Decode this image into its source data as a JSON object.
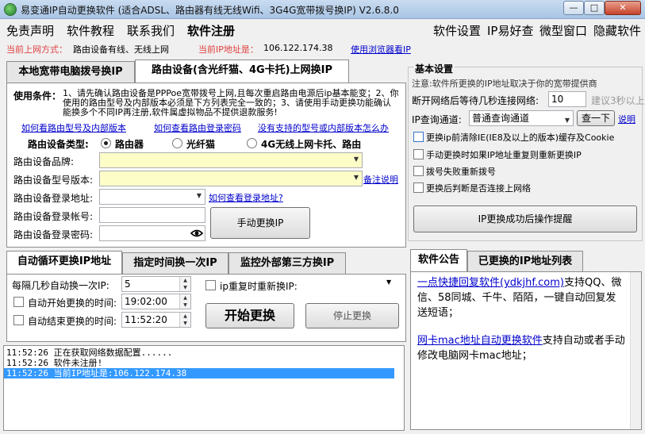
{
  "window": {
    "title": "易变通IP自动更换软件 (适合ADSL、路由器有线无线Wifi、3G4G宽带拨号换IP) V2.6.8.0",
    "min": "—",
    "max": "□",
    "close": "✕"
  },
  "menu": {
    "left": [
      "免责声明",
      "软件教程",
      "联系我们",
      "软件注册"
    ],
    "right": [
      "软件设置",
      "IP易好查",
      "微型窗口",
      "隐藏软件"
    ]
  },
  "status": {
    "mode_label": "当前上网方式：",
    "mode_value": "路由设备有线、无线上网",
    "ip_label": "当前IP地址是：",
    "ip_value": "106.122.174.38",
    "browser_link": "使用浏览器看IP"
  },
  "top_tabs": [
    "本地宽带电脑拨号换IP",
    "路由设备(含光纤猫、4G卡托)上网换IP"
  ],
  "router": {
    "conditions_label": "使用条件：",
    "conditions_text": "1、请先确认路由设备是PPPoe宽带拨号上网,且每次重启路由电源后ip基本能变；2、你使用的路由型号及内部版本必须是下方列表完全一致的；3、请使用手动更换功能确认能换多个不同IP再注册,软件属虚拟物品不提供退款服务!",
    "links": [
      "如何看路由型号及内部版本",
      "如何查看路由登录密码",
      "没有支持的型号或内部版本怎么办"
    ],
    "type_label": "路由设备类型:",
    "types": [
      "路由器",
      "光纤猫",
      "4G无线上网卡托、路由"
    ],
    "brand_label": "路由设备品牌:",
    "model_label": "路由设备型号版本:",
    "note_link": "备注说明",
    "addr_label": "路由设备登录地址:",
    "addr_link": "如何查看登录地址?",
    "account_label": "路由设备登录帐号:",
    "password_label": "路由设备登录密码:",
    "eye_icon": "eye-icon",
    "manual_button": "手动更换IP"
  },
  "bottom_tabs": [
    "自动循环更换IP地址",
    "指定时间换一次IP",
    "监控外部第三方换IP"
  ],
  "auto": {
    "interval_label": "每隔几秒自动换一次IP:",
    "interval_value": "5",
    "start_label": "自动开始更换的时间:",
    "start_value": "19:02:00",
    "end_label": "自动结束更换的时间:",
    "end_value": "11:52:20",
    "repeat_label": "ip重复时重新换IP:",
    "start_button": "开始更换",
    "stop_button": "停止更换"
  },
  "log": [
    {
      "time": "11:52:26",
      "text": "正在获取网络数据配置......"
    },
    {
      "time": "11:52:26",
      "text": "软件未注册!"
    },
    {
      "time": "11:52:26",
      "text": "当前IP地址是:106.122.174.38"
    }
  ],
  "settings": {
    "title": "基本设置",
    "note": "注意:软件所更换的IP地址取决于你的宽带提供商",
    "wait_label": "断开网络后等待几秒连接网络:",
    "wait_value": "10",
    "wait_hint": "建议3秒以上",
    "channel_label": "IP查询通道:",
    "channel_value": "普通查询通道",
    "check_button": "查一下",
    "explain_link": "说明",
    "options": [
      "更换ip前清除IE(IE8及以上的版本)缓存及Cookie",
      "手动更换时如果IP地址重复则重新更换IP",
      "拨号失败重新拨号",
      "更换后判断是否连接上网络"
    ],
    "remind_button": "IP更换成功后操作提醒"
  },
  "side_tabs": [
    "软件公告",
    "已更换的IP地址列表"
  ],
  "notice": {
    "item1_link": "一点快捷回复软件(ydkjhf.com)",
    "item1_text": "支持QQ、微信、58同城、千牛、陌陌，一键自动回复发送短语；",
    "item2_link": "网卡mac地址自动更换软件",
    "item2_text": "支持自动或者手动修改电脑网卡mac地址；"
  }
}
